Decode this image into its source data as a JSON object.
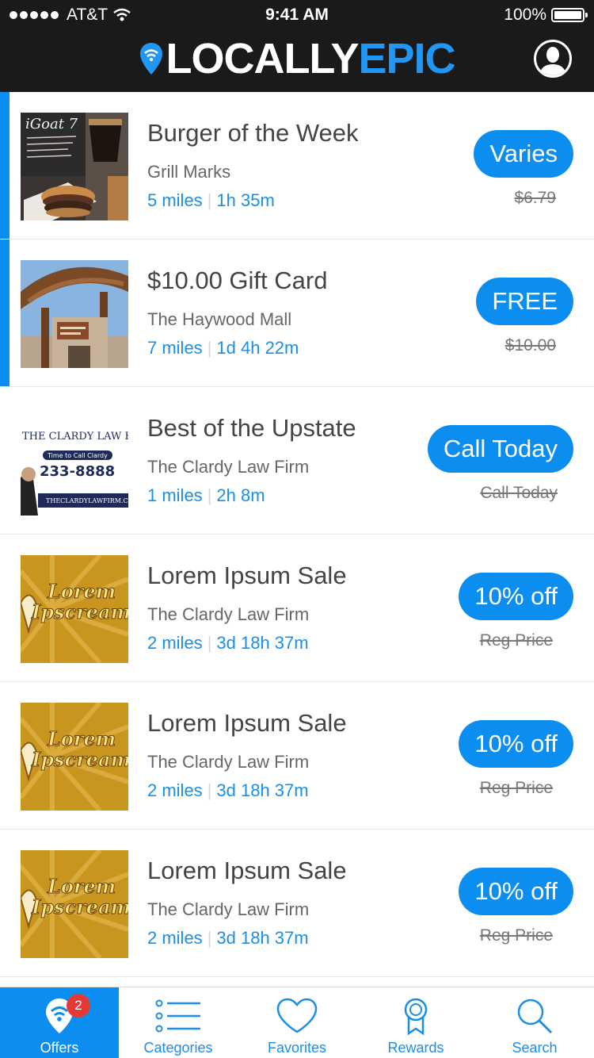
{
  "status_bar": {
    "carrier": "AT&T",
    "time": "9:41 AM",
    "battery": "100%"
  },
  "header": {
    "logo_part1": "LOCALLY",
    "logo_part2": "EPIC"
  },
  "offers": [
    {
      "title": "Burger of the Week",
      "merchant": "Grill Marks",
      "distance": "5 miles",
      "time_left": "1h 35m",
      "price_label": "Varies",
      "original_price": "$6.79",
      "active": true
    },
    {
      "title": "$10.00 Gift Card",
      "merchant": "The Haywood Mall",
      "distance": "7 miles",
      "time_left": "1d 4h 22m",
      "price_label": "FREE",
      "original_price": "$10.00",
      "active": true
    },
    {
      "title": "Best of the Upstate",
      "merchant": "The Clardy Law Firm",
      "distance": "1 miles",
      "time_left": "2h 8m",
      "price_label": "Call Today",
      "original_price": "Call Today",
      "active": false,
      "thumb_text": {
        "firm": "THE CLARDY LAW FI",
        "tagline": "Time to Call Clardy",
        "phone": "233-8888",
        "site": "THECLARDYLAWFIRM.C"
      }
    },
    {
      "title": "Lorem Ipsum Sale",
      "merchant": "The Clardy Law Firm",
      "distance": "2 miles",
      "time_left": "3d 18h 37m",
      "price_label": "10% off",
      "original_price": "Reg Price",
      "active": false
    },
    {
      "title": "Lorem Ipsum Sale",
      "merchant": "The Clardy Law Firm",
      "distance": "2 miles",
      "time_left": "3d 18h 37m",
      "price_label": "10% off",
      "original_price": "Reg Price",
      "active": false
    },
    {
      "title": "Lorem Ipsum Sale",
      "merchant": "The Clardy Law Firm",
      "distance": "2 miles",
      "time_left": "3d 18h 37m",
      "price_label": "10% off",
      "original_price": "Reg Price",
      "active": false
    }
  ],
  "ipscream_text": {
    "line1": "Lorem",
    "line2": "Ipscream"
  },
  "goat_text": "iGoat 7",
  "tabs": [
    {
      "label": "Offers",
      "icon": "offers-pin-icon",
      "badge": "2",
      "active": true
    },
    {
      "label": "Categories",
      "icon": "list-icon"
    },
    {
      "label": "Favorites",
      "icon": "heart-icon"
    },
    {
      "label": "Rewards",
      "icon": "ribbon-icon"
    },
    {
      "label": "Search",
      "icon": "search-icon"
    }
  ],
  "colors": {
    "accent": "#0b8ef0",
    "header_bg": "#1a1a1a",
    "badge": "#e53935"
  }
}
